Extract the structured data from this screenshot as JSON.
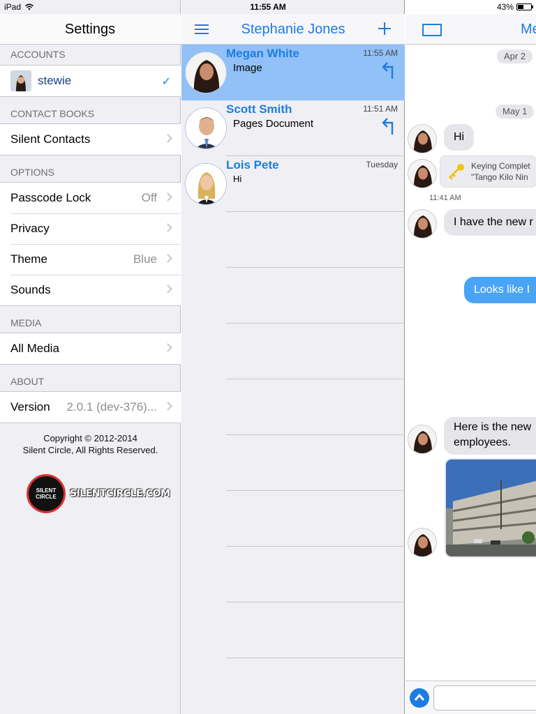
{
  "status_bar": {
    "device": "iPad",
    "time": "11:55 AM",
    "battery": "43%",
    "battery_level": 0.43
  },
  "settings": {
    "title": "Settings",
    "sections": [
      {
        "label": "ACCOUNTS"
      },
      {
        "label": "CONTACT BOOKS"
      },
      {
        "label": "OPTIONS"
      },
      {
        "label": "MEDIA"
      },
      {
        "label": "ABOUT"
      }
    ],
    "account": {
      "name": "stewie"
    },
    "contact_books": {
      "label": "Silent Contacts"
    },
    "options": [
      {
        "label": "Passcode Lock",
        "value": "Off"
      },
      {
        "label": "Privacy",
        "value": ""
      },
      {
        "label": "Theme",
        "value": "Blue"
      },
      {
        "label": "Sounds",
        "value": ""
      }
    ],
    "media": {
      "label": "All Media"
    },
    "about": {
      "label": "Version",
      "value": "2.0.1 (dev-376)..."
    },
    "copyright_line1": "Copyright © 2012-2014",
    "copyright_line2": "Silent Circle, All Rights Reserved.",
    "logo_badge": "SILENT CIRCLE",
    "logo_text": "SILENTCIRCLE.COM"
  },
  "conversations": {
    "title": "Stephanie Jones",
    "items": [
      {
        "name": "Megan White",
        "time": "11:55 AM",
        "subtitle": "Image",
        "selected": true,
        "reply_icon": true
      },
      {
        "name": "Scott Smith",
        "time": "11:51 AM",
        "subtitle": "Pages Document",
        "selected": false,
        "reply_icon": true
      },
      {
        "name": "Lois Pete",
        "time": "Tuesday",
        "subtitle": "Hi",
        "selected": false,
        "reply_icon": false
      }
    ]
  },
  "chat": {
    "title": "Me",
    "date_1": "Apr 2",
    "date_2": "May 1",
    "msg_hi": "Hi",
    "key_line1": "Keying Complet",
    "key_line2": "\"Tango Kilo Nin",
    "time_1": "11:41 AM",
    "msg_new": "I have the new r",
    "msg_me": "Looks like I",
    "msg_here_1": "Here is the new",
    "msg_here_2": "employees."
  },
  "colors": {
    "accent": "#1c7ce4",
    "selected_row": "#91c1f7",
    "my_bubble": "#4aa4f5"
  }
}
